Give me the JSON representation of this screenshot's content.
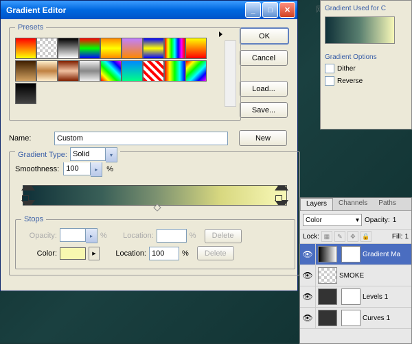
{
  "window": {
    "title": "Gradient Editor"
  },
  "buttons": {
    "ok": "OK",
    "cancel": "Cancel",
    "load": "Load...",
    "save": "Save...",
    "new": "New",
    "delete": "Delete"
  },
  "labels": {
    "presets": "Presets",
    "name": "Name:",
    "gradientType": "Gradient Type:",
    "smoothness": "Smoothness:",
    "stops": "Stops",
    "opacity": "Opacity:",
    "location": "Location:",
    "color": "Color:"
  },
  "values": {
    "name": "Custom",
    "gradientType": "Solid",
    "smoothness": "100",
    "opacityLocation": "",
    "colorLocation": "100",
    "pct": "%"
  },
  "gradUsed": {
    "title": "Gradient Used for C",
    "optionsTitle": "Gradient Options",
    "dither": "Dither",
    "reverse": "Reverse"
  },
  "layers": {
    "tabs": [
      "Layers",
      "Channels",
      "Paths"
    ],
    "mode": "Color",
    "opacity": "Opacity:",
    "opacityVal": "1",
    "lock": "Lock:",
    "fill": "Fill:",
    "fillVal": "1",
    "items": [
      {
        "name": "Gradient Ma"
      },
      {
        "name": "SMOKE"
      },
      {
        "name": "Levels 1"
      },
      {
        "name": "Curves 1"
      }
    ]
  },
  "watermark": "网页教学网"
}
